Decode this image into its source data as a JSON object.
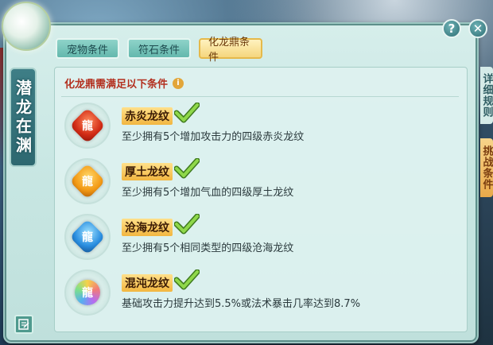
{
  "window": {
    "side_title": "潜龙在渊",
    "help_label": "?",
    "close_label": "✕"
  },
  "tabs": [
    {
      "label": "宠物条件",
      "active": false
    },
    {
      "label": "符石条件",
      "active": false
    },
    {
      "label": "化龙鼎条件",
      "active": true
    }
  ],
  "right_tabs": {
    "rules": "详细规则",
    "challenge": "挑战条件"
  },
  "content": {
    "heading": "化龙鼎需满足以下条件",
    "info_icon": "i",
    "requirements": [
      {
        "name": "赤炎龙纹",
        "desc": "至少拥有5个增加攻击力的四级赤炎龙纹",
        "icon": "red-dragon-rune-icon",
        "met": true
      },
      {
        "name": "厚土龙纹",
        "desc": "至少拥有5个增加气血的四级厚土龙纹",
        "icon": "earth-dragon-rune-icon",
        "met": true
      },
      {
        "name": "沧海龙纹",
        "desc": "至少拥有5个相同类型的四级沧海龙纹",
        "icon": "sea-dragon-rune-icon",
        "met": true
      },
      {
        "name": "混沌龙纹",
        "desc": "基础攻击力提升达到5.5%或法术暴击几率达到8.7%",
        "icon": "chaos-dragon-rune-icon",
        "met": true
      }
    ]
  },
  "colors": {
    "heading": "#b3301f",
    "check": "#7cc43a",
    "active_tab": "#f5d67e"
  }
}
